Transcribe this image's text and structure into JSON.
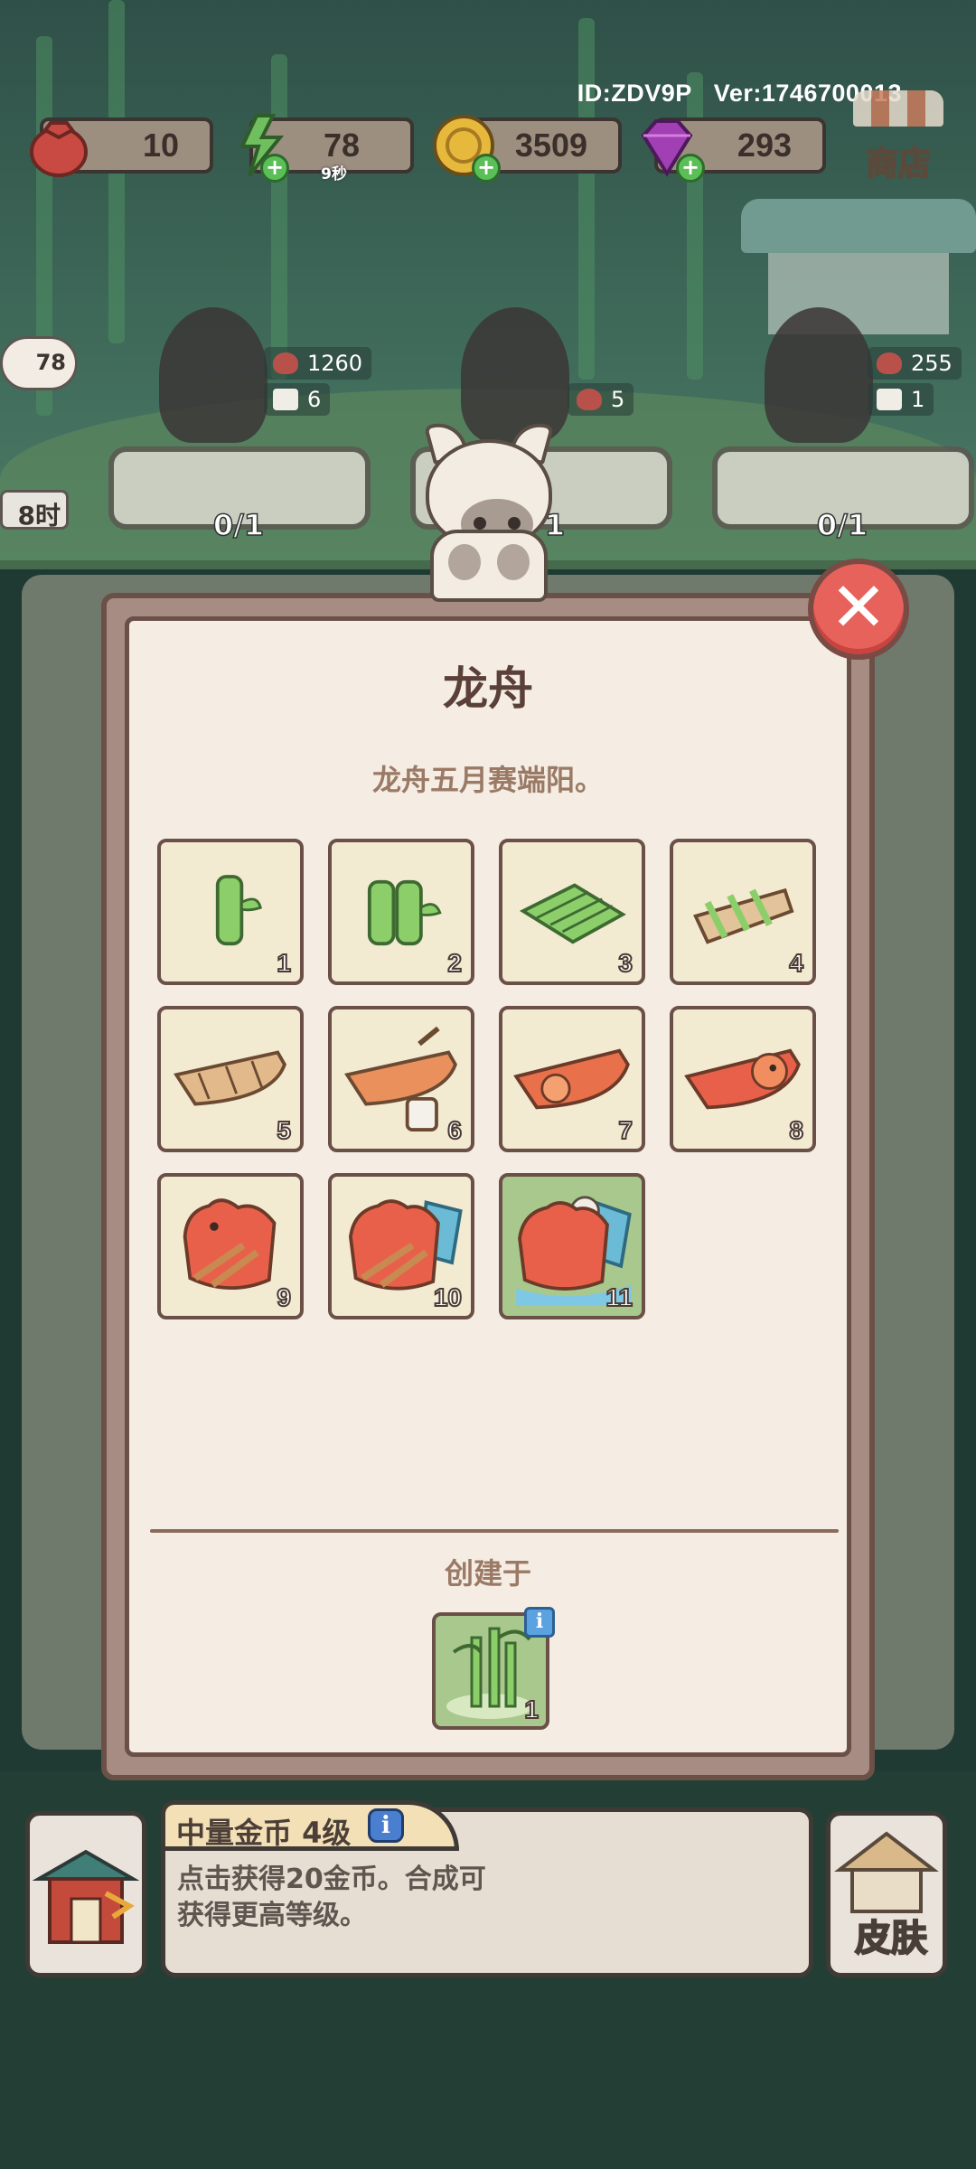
{
  "header": {
    "id_label": "ID:ZDV9P",
    "version_label": "Ver:1746700013"
  },
  "resources": {
    "bag": {
      "value": "10",
      "icon": "bag-icon"
    },
    "energy": {
      "value": "78",
      "timer": "9秒",
      "icon": "lightning-icon"
    },
    "coins": {
      "value": "3509",
      "icon": "coin-icon"
    },
    "gems": {
      "value": "293",
      "icon": "gem-icon"
    },
    "shop_label": "商店"
  },
  "stations": {
    "left_energy": "78",
    "left_timer": "8时",
    "slots": [
      "0/1",
      "1",
      "0/1"
    ],
    "station1_chip_bag": "1260",
    "station1_chip_dice": "6",
    "station2_chip_bag": "5",
    "station3_chip_bag": "255",
    "station3_chip_dice": "1"
  },
  "modal": {
    "title": "龙舟",
    "description": "龙舟五月赛端阳。",
    "items": [
      {
        "level": "1",
        "icon": "bamboo-segment-icon"
      },
      {
        "level": "2",
        "icon": "double-bamboo-icon"
      },
      {
        "level": "3",
        "icon": "bamboo-mat-icon"
      },
      {
        "level": "4",
        "icon": "bamboo-frame-icon"
      },
      {
        "level": "5",
        "icon": "wooden-boat-icon"
      },
      {
        "level": "6",
        "icon": "boat-paint-icon"
      },
      {
        "level": "7",
        "icon": "red-boat-icon"
      },
      {
        "level": "8",
        "icon": "dragon-boat-icon"
      },
      {
        "level": "9",
        "icon": "dragon-head-boat-icon"
      },
      {
        "level": "10",
        "icon": "dragon-boat-rowing-icon"
      },
      {
        "level": "11",
        "icon": "dragon-boat-race-icon"
      }
    ],
    "created_label": "创建于",
    "source": {
      "level": "1",
      "icon": "bamboo-grove-icon",
      "info_glyph": "i"
    },
    "close_glyph": "✕"
  },
  "bottom": {
    "item_name": "中量金币 4级",
    "info_glyph": "i",
    "description_line1": "点击获得20金币。合成可",
    "description_line2": "获得更高等级。",
    "skin_label": "皮肤"
  },
  "colors": {
    "panel_bg": "#f5ede3",
    "panel_border": "#6b5048",
    "cell_bg": "#f3ead2",
    "cell_highlight": "#a8c88d",
    "close_red": "#e8625c"
  }
}
